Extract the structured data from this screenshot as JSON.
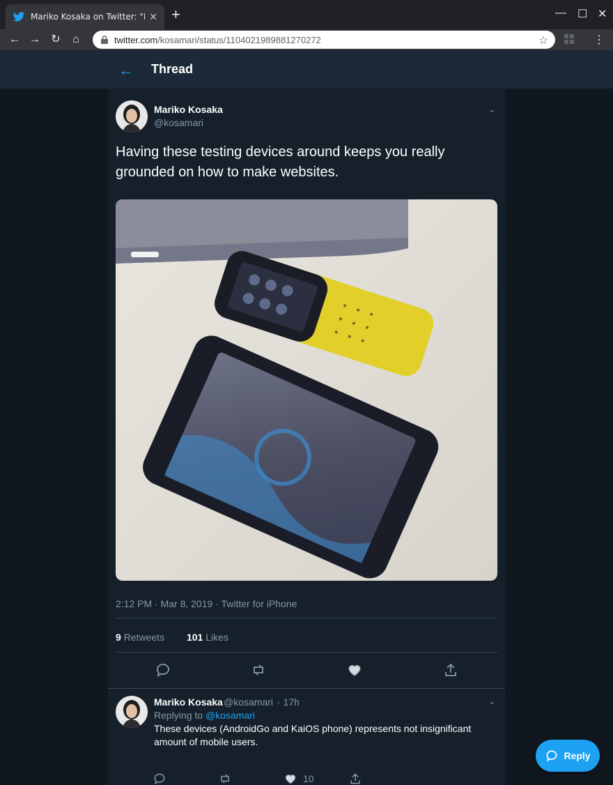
{
  "browser": {
    "tab_title": "Mariko Kosaka on Twitter: \"Havin",
    "url_host": "twitter.com",
    "url_path": "/kosamari/status/1104021989881270272"
  },
  "header": {
    "title": "Thread"
  },
  "tweet": {
    "name": "Mariko Kosaka",
    "handle": "@kosamari",
    "text": "Having these testing devices around keeps you really grounded on how to make websites.",
    "timestamp": "2:12 PM · Mar 8, 2019 · Twitter for iPhone",
    "retweets_count": "9",
    "retweets_label": "Retweets",
    "likes_count": "101",
    "likes_label": "Likes"
  },
  "reply": {
    "name": "Mariko Kosaka",
    "handle": "@kosamari",
    "time": "· 17h",
    "replying_prefix": "Replying to",
    "replying_to": "@kosamari",
    "text": "These devices (AndroidGo and KaiOS phone) represents not insignificant amount of mobile users.",
    "like_count": "10"
  },
  "fab": {
    "label": "Reply"
  },
  "colors": {
    "accent": "#1da1f2",
    "background": "#15202b",
    "header": "#1c2938",
    "muted": "#8899a6"
  }
}
